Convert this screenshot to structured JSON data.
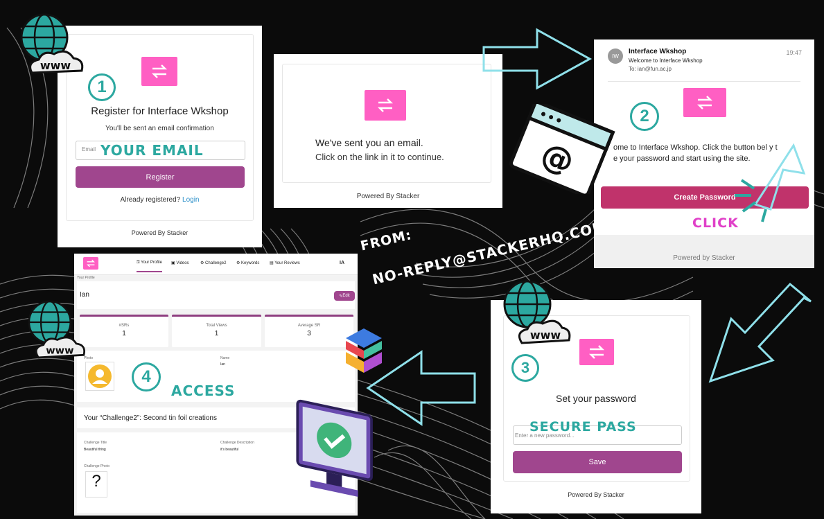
{
  "colors": {
    "accent": "#a0468e",
    "logo": "#ff5fc3",
    "teal": "#2ca8a0",
    "click": "#e040c8"
  },
  "panel1": {
    "step": "1",
    "title": "Register for Interface Wkshop",
    "subtitle": "You'll be sent an email confirmation",
    "email_placeholder": "Email",
    "overlay": "YOUR EMAIL",
    "register_label": "Register",
    "already": "Already registered?",
    "login_link": "Login",
    "powered": "Powered By Stacker"
  },
  "panel2": {
    "line1": "We've sent you an email.",
    "line2": "Click on the link in it to continue.",
    "powered": "Powered By Stacker"
  },
  "panel3": {
    "avatar": "IW",
    "sender": "Interface Wkshop",
    "time": "19:47",
    "subject": "Welcome to Interface Wkshop",
    "to": "To: ian@fun.ac.jp",
    "step": "2",
    "body1": "ome to Interface Wkshop. Click the button bel",
    "body1b": "y t",
    "body2": "e your password and start using the site.",
    "button": "Create Password",
    "overlay": "CLICK",
    "powered": "Powered by Stacker"
  },
  "from": {
    "line1": "FROM:",
    "line2": "NO-REPLY@STACKERHQ.COM"
  },
  "panel4": {
    "nav": [
      {
        "label": "Your Profile",
        "icon": "profile-icon"
      },
      {
        "label": "Videos",
        "icon": "video-icon"
      },
      {
        "label": "Challenge2",
        "icon": "gear-icon"
      },
      {
        "label": "Keywords",
        "icon": "gear-icon"
      },
      {
        "label": "Your Reviews",
        "icon": "review-icon"
      }
    ],
    "initials": "IA",
    "breadcrumb": "Your Profile",
    "name": "Ian",
    "edit": "Edit",
    "stats": [
      {
        "label": "#SRs",
        "value": "1"
      },
      {
        "label": "Total Views",
        "value": "1"
      },
      {
        "label": "Average SR",
        "value": "3"
      }
    ],
    "photo_label": "Photo",
    "name_label": "Name",
    "name_value": "Ian",
    "step": "4",
    "overlay": "ACCESS",
    "challenge_heading": "Your “Challenge2”: Second tin foil creations",
    "challenge_title_label": "Challenge Title",
    "challenge_title": "Beautiful thing",
    "challenge_desc_label": "Challenge Description",
    "challenge_desc": "it's beautiful",
    "challenge_photo_label": "Challenge Photo"
  },
  "panel5": {
    "step": "3",
    "title": "Set your password",
    "placeholder": "Enter a new password...",
    "overlay": "SECURE PASS",
    "save": "Save",
    "powered": "Powered By Stacker"
  },
  "icons": {
    "www": "www-globe-icon",
    "mail": "mail-browser-icon",
    "monitor": "monitor-check-icon",
    "stack": "stacker-logo-icon",
    "pointer": "click-pointer-icon"
  }
}
